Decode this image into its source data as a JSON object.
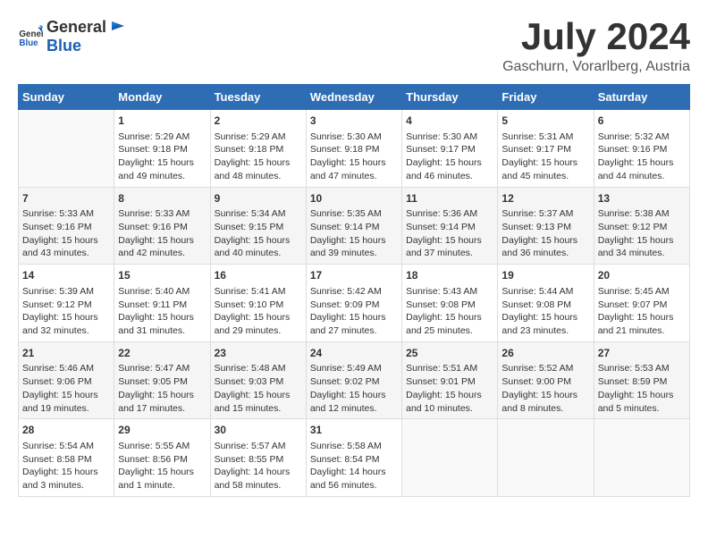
{
  "header": {
    "logo_general": "General",
    "logo_blue": "Blue",
    "title": "July 2024",
    "subtitle": "Gaschurn, Vorarlberg, Austria"
  },
  "days_of_week": [
    "Sunday",
    "Monday",
    "Tuesday",
    "Wednesday",
    "Thursday",
    "Friday",
    "Saturday"
  ],
  "weeks": [
    [
      {
        "day": "",
        "info": ""
      },
      {
        "day": "1",
        "info": "Sunrise: 5:29 AM\nSunset: 9:18 PM\nDaylight: 15 hours\nand 49 minutes."
      },
      {
        "day": "2",
        "info": "Sunrise: 5:29 AM\nSunset: 9:18 PM\nDaylight: 15 hours\nand 48 minutes."
      },
      {
        "day": "3",
        "info": "Sunrise: 5:30 AM\nSunset: 9:18 PM\nDaylight: 15 hours\nand 47 minutes."
      },
      {
        "day": "4",
        "info": "Sunrise: 5:30 AM\nSunset: 9:17 PM\nDaylight: 15 hours\nand 46 minutes."
      },
      {
        "day": "5",
        "info": "Sunrise: 5:31 AM\nSunset: 9:17 PM\nDaylight: 15 hours\nand 45 minutes."
      },
      {
        "day": "6",
        "info": "Sunrise: 5:32 AM\nSunset: 9:16 PM\nDaylight: 15 hours\nand 44 minutes."
      }
    ],
    [
      {
        "day": "7",
        "info": "Sunrise: 5:33 AM\nSunset: 9:16 PM\nDaylight: 15 hours\nand 43 minutes."
      },
      {
        "day": "8",
        "info": "Sunrise: 5:33 AM\nSunset: 9:16 PM\nDaylight: 15 hours\nand 42 minutes."
      },
      {
        "day": "9",
        "info": "Sunrise: 5:34 AM\nSunset: 9:15 PM\nDaylight: 15 hours\nand 40 minutes."
      },
      {
        "day": "10",
        "info": "Sunrise: 5:35 AM\nSunset: 9:14 PM\nDaylight: 15 hours\nand 39 minutes."
      },
      {
        "day": "11",
        "info": "Sunrise: 5:36 AM\nSunset: 9:14 PM\nDaylight: 15 hours\nand 37 minutes."
      },
      {
        "day": "12",
        "info": "Sunrise: 5:37 AM\nSunset: 9:13 PM\nDaylight: 15 hours\nand 36 minutes."
      },
      {
        "day": "13",
        "info": "Sunrise: 5:38 AM\nSunset: 9:12 PM\nDaylight: 15 hours\nand 34 minutes."
      }
    ],
    [
      {
        "day": "14",
        "info": "Sunrise: 5:39 AM\nSunset: 9:12 PM\nDaylight: 15 hours\nand 32 minutes."
      },
      {
        "day": "15",
        "info": "Sunrise: 5:40 AM\nSunset: 9:11 PM\nDaylight: 15 hours\nand 31 minutes."
      },
      {
        "day": "16",
        "info": "Sunrise: 5:41 AM\nSunset: 9:10 PM\nDaylight: 15 hours\nand 29 minutes."
      },
      {
        "day": "17",
        "info": "Sunrise: 5:42 AM\nSunset: 9:09 PM\nDaylight: 15 hours\nand 27 minutes."
      },
      {
        "day": "18",
        "info": "Sunrise: 5:43 AM\nSunset: 9:08 PM\nDaylight: 15 hours\nand 25 minutes."
      },
      {
        "day": "19",
        "info": "Sunrise: 5:44 AM\nSunset: 9:08 PM\nDaylight: 15 hours\nand 23 minutes."
      },
      {
        "day": "20",
        "info": "Sunrise: 5:45 AM\nSunset: 9:07 PM\nDaylight: 15 hours\nand 21 minutes."
      }
    ],
    [
      {
        "day": "21",
        "info": "Sunrise: 5:46 AM\nSunset: 9:06 PM\nDaylight: 15 hours\nand 19 minutes."
      },
      {
        "day": "22",
        "info": "Sunrise: 5:47 AM\nSunset: 9:05 PM\nDaylight: 15 hours\nand 17 minutes."
      },
      {
        "day": "23",
        "info": "Sunrise: 5:48 AM\nSunset: 9:03 PM\nDaylight: 15 hours\nand 15 minutes."
      },
      {
        "day": "24",
        "info": "Sunrise: 5:49 AM\nSunset: 9:02 PM\nDaylight: 15 hours\nand 12 minutes."
      },
      {
        "day": "25",
        "info": "Sunrise: 5:51 AM\nSunset: 9:01 PM\nDaylight: 15 hours\nand 10 minutes."
      },
      {
        "day": "26",
        "info": "Sunrise: 5:52 AM\nSunset: 9:00 PM\nDaylight: 15 hours\nand 8 minutes."
      },
      {
        "day": "27",
        "info": "Sunrise: 5:53 AM\nSunset: 8:59 PM\nDaylight: 15 hours\nand 5 minutes."
      }
    ],
    [
      {
        "day": "28",
        "info": "Sunrise: 5:54 AM\nSunset: 8:58 PM\nDaylight: 15 hours\nand 3 minutes."
      },
      {
        "day": "29",
        "info": "Sunrise: 5:55 AM\nSunset: 8:56 PM\nDaylight: 15 hours\nand 1 minute."
      },
      {
        "day": "30",
        "info": "Sunrise: 5:57 AM\nSunset: 8:55 PM\nDaylight: 14 hours\nand 58 minutes."
      },
      {
        "day": "31",
        "info": "Sunrise: 5:58 AM\nSunset: 8:54 PM\nDaylight: 14 hours\nand 56 minutes."
      },
      {
        "day": "",
        "info": ""
      },
      {
        "day": "",
        "info": ""
      },
      {
        "day": "",
        "info": ""
      }
    ]
  ]
}
